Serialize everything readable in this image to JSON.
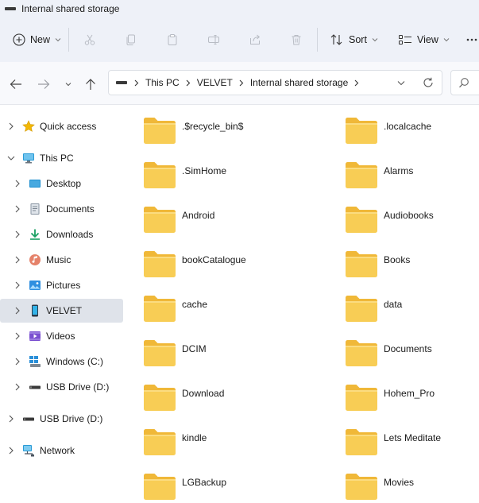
{
  "window": {
    "title": "Internal shared storage"
  },
  "toolbar": {
    "new_label": "New",
    "sort_label": "Sort",
    "view_label": "View"
  },
  "address": {
    "crumbs": [
      "This PC",
      "VELVET",
      "Internal shared storage"
    ]
  },
  "sidebar": {
    "items": [
      {
        "label": "Quick access",
        "icon": "star-icon"
      },
      {
        "label": "This PC",
        "icon": "computer-icon"
      },
      {
        "label": "Desktop",
        "icon": "desktop-icon"
      },
      {
        "label": "Documents",
        "icon": "documents-icon"
      },
      {
        "label": "Downloads",
        "icon": "download-arrow-icon"
      },
      {
        "label": "Music",
        "icon": "music-icon"
      },
      {
        "label": "Pictures",
        "icon": "pictures-icon"
      },
      {
        "label": "VELVET",
        "icon": "phone-icon"
      },
      {
        "label": "Videos",
        "icon": "videos-icon"
      },
      {
        "label": "Windows (C:)",
        "icon": "windows-drive-icon"
      },
      {
        "label": "USB Drive (D:)",
        "icon": "usb-drive-icon"
      },
      {
        "label": "USB Drive (D:)",
        "icon": "usb-drive-icon"
      },
      {
        "label": "Network",
        "icon": "network-icon"
      }
    ],
    "selected": "VELVET",
    "accent": "#dfe3ea"
  },
  "folders": [
    ".$recycle_bin$",
    ".localcache",
    ".SimHome",
    "Alarms",
    "Android",
    "Audiobooks",
    "bookCatalogue",
    "Books",
    "cache",
    "data",
    "DCIM",
    "Documents",
    "Download",
    "Hohem_Pro",
    "kindle",
    "Lets Meditate",
    "LGBackup",
    "Movies"
  ],
  "colors": {
    "folder": "#f8c94a",
    "folder_back": "#f0b838",
    "chrome": "#eef1f8"
  }
}
